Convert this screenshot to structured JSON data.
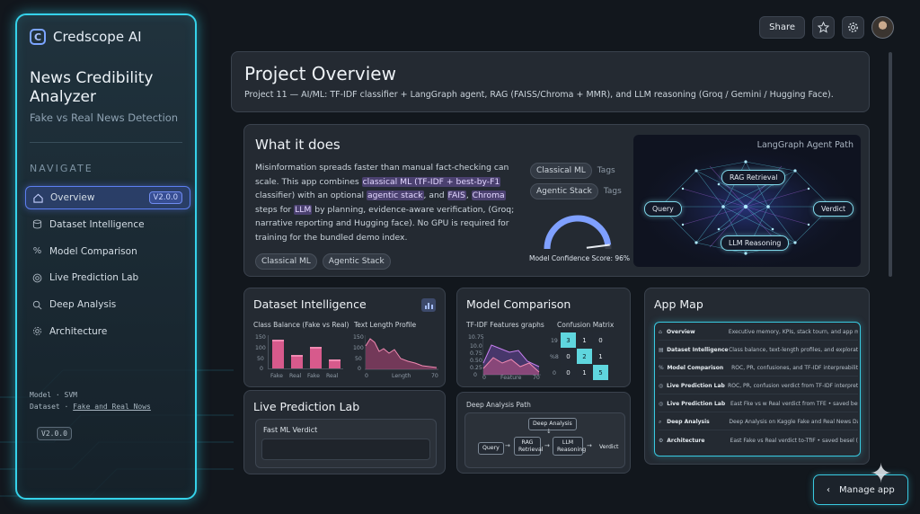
{
  "sidebar": {
    "brand": "Credscope AI",
    "title": "News Credibility Analyzer",
    "subtitle": "Fake vs Real News Detection",
    "nav_heading": "NAVIGATE",
    "items": [
      {
        "label": "Overview",
        "icon": "home-icon",
        "badge": "V2.0.0",
        "active": true
      },
      {
        "label": "Dataset Intelligence",
        "icon": "database-icon"
      },
      {
        "label": "Model Comparison",
        "icon": "percent-icon"
      },
      {
        "label": "Live Prediction Lab",
        "icon": "target-icon"
      },
      {
        "label": "Deep Analysis",
        "icon": "search-icon"
      },
      {
        "label": "Architecture",
        "icon": "settings-icon"
      }
    ],
    "meta_model_key": "Model",
    "meta_model_val": "SVM",
    "meta_dataset_key": "Dataset",
    "meta_dataset_val": "Fake and Real Nows",
    "version": "V2.0.0"
  },
  "topbar": {
    "share": "Share",
    "star_icon": "star-icon",
    "settings_icon": "gear-icon"
  },
  "overview": {
    "title": "Project Overview",
    "description": "Project 11 — AI/ML: TF-IDF classifier + LangGraph agent, RAG (FAISS/Chroma + MMR), and LLM reasoning (Groq / Gemini / Hugging Face)."
  },
  "what": {
    "title": "What it does",
    "t1": "Misinformation spreads faster than manual fact-checking can scale. This app combines ",
    "h1": "classical ML (TF-IDF + best-by-F1",
    "t2": " classifier) with an optional ",
    "h2": "agentic stack",
    "t3": ", and ",
    "h3": "FAIS",
    "t4": ", ",
    "h4": "Chroma",
    "t5": " steps for ",
    "h5": "LLM",
    "t6": " by planning, evidence-aware verification, (Groq; narrative reporting and Hugging face). No GPU is required for training for the bundled demo index.",
    "chips": [
      "Classical ML",
      "Agentic Stack"
    ],
    "tag1": "Classical ML",
    "tag2": "Agentic Stack",
    "tags_label": "Tags",
    "gauge_label": "Model Confidence Score: 96%",
    "gauge_value": 0.96
  },
  "langgraph": {
    "title": "LangGraph Agent Path",
    "nodes": {
      "query": "Query",
      "rag": "RAG Retrieval",
      "llm": "LLM Reasoning",
      "verdict": "Verdict"
    }
  },
  "dataset": {
    "title": "Dataset Intelligence",
    "chart1_title": "Class Balance (Fake vs Real)",
    "chart1_yticks": [
      "150",
      "100",
      "50",
      "0"
    ],
    "chart1_cats": [
      "Fake",
      "Real",
      "Fake",
      "Real"
    ],
    "chart1_values": [
      125,
      60,
      95,
      40
    ],
    "chart2_title": "Text Length Profile",
    "chart2_yticks": [
      "150",
      "100",
      "50",
      "0"
    ],
    "chart2_xticks": [
      "0",
      "Length",
      "70"
    ]
  },
  "model": {
    "title": "Model Comparison",
    "chart1_title": "TF-IDF Features graphs",
    "chart1_yticks": [
      "10.75",
      "10.0",
      "0.75",
      "0.50",
      "0.25",
      "0"
    ],
    "chart1_xticks": [
      "0",
      "Feature",
      "70"
    ],
    "cm_title": "Confusion Matrix",
    "cm_row_labels": [
      "19",
      "%8",
      "0"
    ],
    "cm_values": [
      "3",
      "1",
      "0",
      "0",
      "2",
      "1",
      "0",
      "1",
      "5"
    ]
  },
  "appmap": {
    "title": "App Map",
    "rows": [
      {
        "name": "Overview",
        "desc": "Executive memory, KPIs, stack tourn, and app map..."
      },
      {
        "name": "Dataset Intelligence",
        "desc": "Class balance, text-length profiles, and exploratory..."
      },
      {
        "name": "Model Comparison",
        "desc": "ROC, PR, confusiones, and TF-IDF interpreability..."
      },
      {
        "name": "Live Prediction Lab",
        "desc": "ROC, PR, confusion verdict from TF-IDF interpretabil..."
      },
      {
        "name": "Live Prediction Lab",
        "desc": "East Fke vs w Real verdict from TFE • saved best..."
      },
      {
        "name": "Deep Analysis",
        "desc": "Deep Analysis on Kaggle Fake and Real News Data..."
      },
      {
        "name": "Architecture",
        "desc": "East Fake vs Real verdict to-TfIF • saved besel (m..."
      }
    ]
  },
  "live": {
    "title": "Live Prediction Lab",
    "fast_title": "Fast ML Verdict"
  },
  "deep": {
    "title": "Deep Analysis Path",
    "nodes": {
      "deep": "Deep Analysis",
      "query": "Query",
      "rag": "RAG Retrieval",
      "llm": "LLM Reasoning",
      "verdict": "Verdict"
    }
  },
  "manage": {
    "label": "Manage app"
  },
  "colors": {
    "accent": "#35d2ea",
    "active": "#5c7ef0",
    "bar": "#d75a8c",
    "cm_high": "#5fd6de"
  }
}
